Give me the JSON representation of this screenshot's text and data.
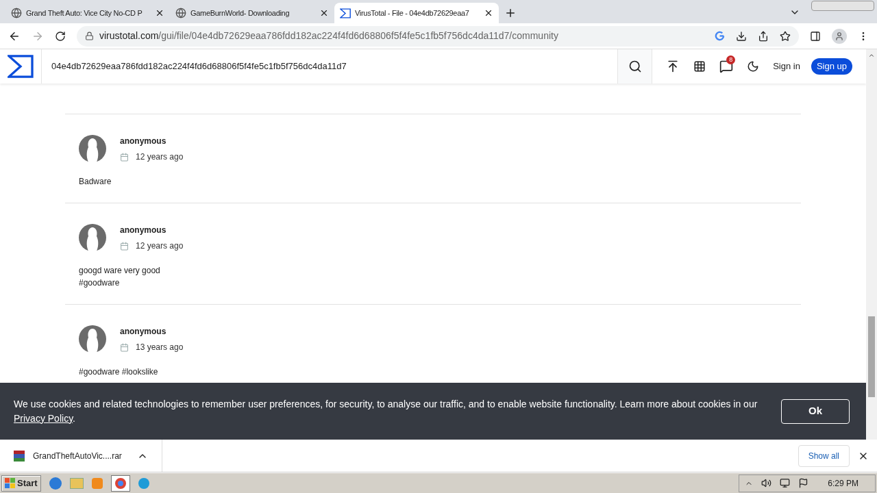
{
  "browser": {
    "tabs": [
      {
        "title": "Grand Theft Auto: Vice City No-CD P",
        "selected": false
      },
      {
        "title": "GameBurnWorld- Downloading",
        "selected": false
      },
      {
        "title": "VirusTotal - File - 04e4db72629eaa7",
        "selected": true
      }
    ],
    "url_host": "virustotal.com",
    "url_path": "/gui/file/04e4db72629eaa786fdd182ac224f4fd6d68806f5f4fe5c1fb5f756dc4da11d7/community"
  },
  "header": {
    "search_value": "04e4db72629eaa786fdd182ac224f4fd6d68806f5f4fe5c1fb5f756dc4da11d7",
    "notification_count": "8",
    "sign_in": "Sign in",
    "sign_up": "Sign up"
  },
  "comments": [
    {
      "author": "anonymous",
      "date": "12 years ago",
      "lines": [
        "Badware"
      ]
    },
    {
      "author": "anonymous",
      "date": "12 years ago",
      "lines": [
        "googd ware very good",
        "#goodware"
      ]
    },
    {
      "author": "anonymous",
      "date": "13 years ago",
      "lines": [
        "#goodware #lookslike"
      ]
    }
  ],
  "cookie_banner": {
    "text": "We use cookies and related technologies to remember user preferences, for security, to analyse our traffic, and to enable website functionality. Learn more about cookies in our",
    "link": "Privacy Policy",
    "after_link": ".",
    "button": "Ok"
  },
  "download_bar": {
    "file": "GrandTheftAutoVic....rar",
    "show_all": "Show all"
  },
  "taskbar": {
    "start": "Start",
    "clock": "6:29 PM"
  }
}
